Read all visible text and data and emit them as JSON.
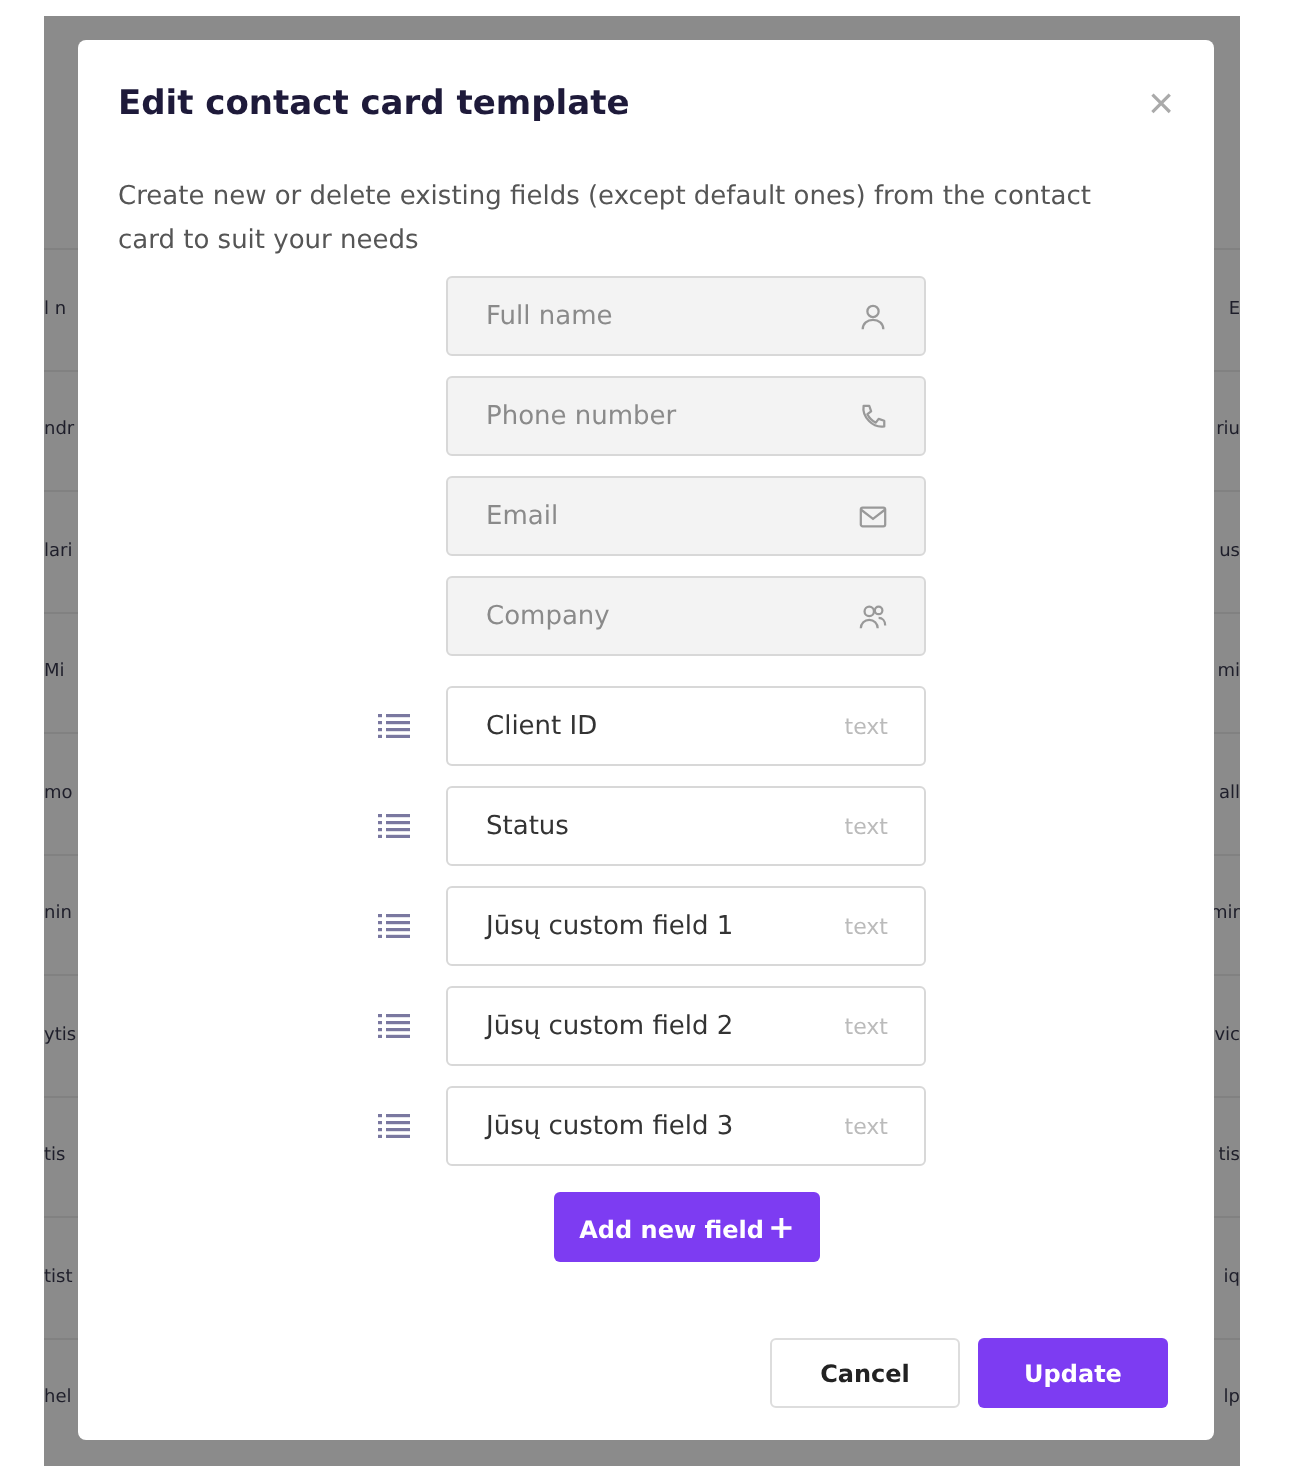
{
  "backdrop": {
    "left_column": [
      "l n",
      "ndr",
      "lari",
      "Mi",
      "mo",
      "nin",
      "ytis",
      "tis",
      "tist",
      "hel"
    ],
    "right_column": [
      "E",
      "riu",
      "us",
      "mi",
      "all",
      "mir",
      "vic",
      "tis",
      "iq",
      "lp"
    ]
  },
  "dialog": {
    "title": "Edit contact card template",
    "close": "×",
    "description": "Create new or delete existing fields (except default ones) from the contact card to suit your needs",
    "default_fields": [
      {
        "label": "Full name",
        "kind": "person"
      },
      {
        "label": "Phone number",
        "kind": "phone"
      },
      {
        "label": "Email",
        "kind": "mail"
      },
      {
        "label": "Company",
        "kind": "people"
      }
    ],
    "custom_fields": [
      {
        "label": "Client ID",
        "type": "text"
      },
      {
        "label": "Status",
        "type": "text"
      },
      {
        "label": "Jūsų custom field 1",
        "type": "text"
      },
      {
        "label": "Jūsų custom field 2",
        "type": "text"
      },
      {
        "label": "Jūsų custom field 3",
        "type": "text"
      }
    ],
    "add_button": {
      "label": "Add new field",
      "icon": "+"
    },
    "buttons": [
      {
        "label": "Cancel",
        "kind": "secondary"
      },
      {
        "label": "Update",
        "kind": "primary"
      }
    ]
  }
}
